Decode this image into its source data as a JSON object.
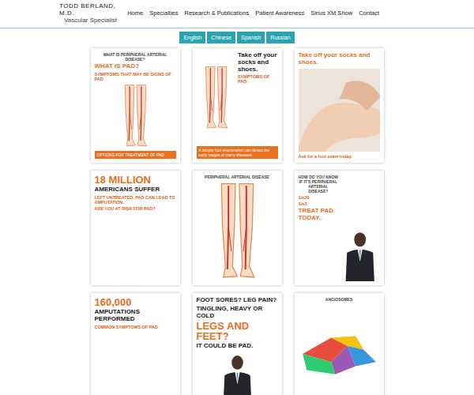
{
  "header": {
    "name": "TODD BERLAND, M.D.",
    "subtitle": "Vascular Specialist"
  },
  "nav": [
    "Home",
    "Specialties",
    "Research & Publications",
    "Patient Awareness",
    "Sirius XM Show",
    "Contact"
  ],
  "languages": [
    "English",
    "Chinese",
    "Spanish",
    "Russian"
  ],
  "posters": [
    {
      "layout": "column",
      "figure": "legs",
      "top": [
        {
          "text": "WHAT IS PERIPHERAL ARTERIAL DISEASE?",
          "role": "kicker"
        },
        {
          "text": "WHAT IS PAD?",
          "role": "head-orange"
        },
        {
          "text": "SYMPTOMS THAT MAY BE SIGNS OF PAD",
          "role": "accent"
        }
      ],
      "bottom": [
        {
          "text": "OPTIONS FOR TREATMENT OF PAD",
          "role": "banner"
        }
      ]
    },
    {
      "layout": "row-figure-first",
      "figure": "legs",
      "top": [
        {
          "text": "Take off your socks and shoes.",
          "role": "head"
        },
        {
          "text": "SYMPTOMS OF PAD:",
          "role": "accent"
        }
      ],
      "bottom": [
        {
          "text": "A simple foot examination can detect the early stages of many diseases",
          "role": "banner"
        }
      ]
    },
    {
      "layout": "column",
      "figure": "photo",
      "top": [
        {
          "text": "Take off your socks and shoes.",
          "role": "head-orange"
        }
      ],
      "bottom": [
        {
          "text": "Ask for a foot exam today.",
          "role": "accent"
        }
      ]
    },
    {
      "layout": "column",
      "figure": "none",
      "top": [
        {
          "text": "18 MILLION",
          "role": "big-orange"
        },
        {
          "text": "AMERICANS SUFFER",
          "role": "head"
        },
        {
          "text": "LEFT UNTREATED, PAD CAN LEAD TO AMPUTATION.",
          "role": "accent"
        },
        {
          "text": "ARE YOU AT RISK FOR PAD?",
          "role": "accent"
        }
      ],
      "bottom": []
    },
    {
      "layout": "column",
      "figure": "arteries",
      "top": [
        {
          "text": "PERIPHERAL ARTERIAL DISEASE",
          "role": "kicker"
        }
      ],
      "bottom": []
    },
    {
      "layout": "row",
      "figure": "man",
      "top": [
        {
          "text": "HOW DO YOU KNOW IF IT'S PERIPHERAL ARTERIAL DISEASE?",
          "role": "kicker"
        },
        {
          "text": "1in20",
          "role": "accent"
        },
        {
          "text": "1in3",
          "role": "accent"
        },
        {
          "text": "TREAT PAD TODAY.",
          "role": "head-orange"
        }
      ],
      "bottom": []
    },
    {
      "layout": "column",
      "figure": "none",
      "top": [
        {
          "text": "160,000",
          "role": "big-orange"
        },
        {
          "text": "AMPUTATIONS PERFORMED",
          "role": "head"
        },
        {
          "text": "COMMON SYMPTOMS OF PAD",
          "role": "accent"
        }
      ],
      "bottom": []
    },
    {
      "layout": "column",
      "figure": "man",
      "top": [
        {
          "text": "FOOT SORES? LEG PAIN?",
          "role": "head"
        },
        {
          "text": "TINGLING, HEAVY OR COLD",
          "role": "head"
        },
        {
          "text": "LEGS AND FEET?",
          "role": "big-orange"
        },
        {
          "text": "IT COULD BE PAD.",
          "role": "head"
        }
      ],
      "bottom": []
    },
    {
      "layout": "column",
      "figure": "foot",
      "top": [
        {
          "text": "ANGIOSOMES",
          "role": "kicker"
        }
      ],
      "bottom": []
    }
  ]
}
